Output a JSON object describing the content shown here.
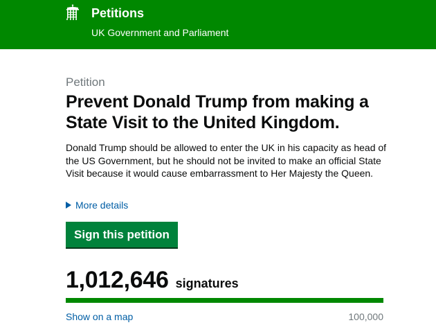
{
  "header": {
    "crest_icon": "portcullis-icon",
    "title": "Petitions",
    "subtitle": "UK Government and Parliament",
    "background": "#008800"
  },
  "petition": {
    "caption": "Petition",
    "title": "Prevent Donald Trump from making a State Visit to the United Kingdom.",
    "description": "Donald Trump should be allowed to enter the UK in his capacity as head of the US Government, but he should not be invited to make an official State Visit because it would cause embarrassment to Her Majesty the Queen.",
    "more_details": "More details",
    "sign_button": "Sign this petition"
  },
  "signatures": {
    "count": "1,012,646",
    "label": "signatures",
    "progress_fraction": 1.0,
    "map_link": "Show on a map",
    "threshold": "100,000"
  },
  "colors": {
    "brand_green": "#008800",
    "button_green": "#00823b",
    "link_blue": "#005ea5",
    "secondary_text": "#6f777b"
  }
}
